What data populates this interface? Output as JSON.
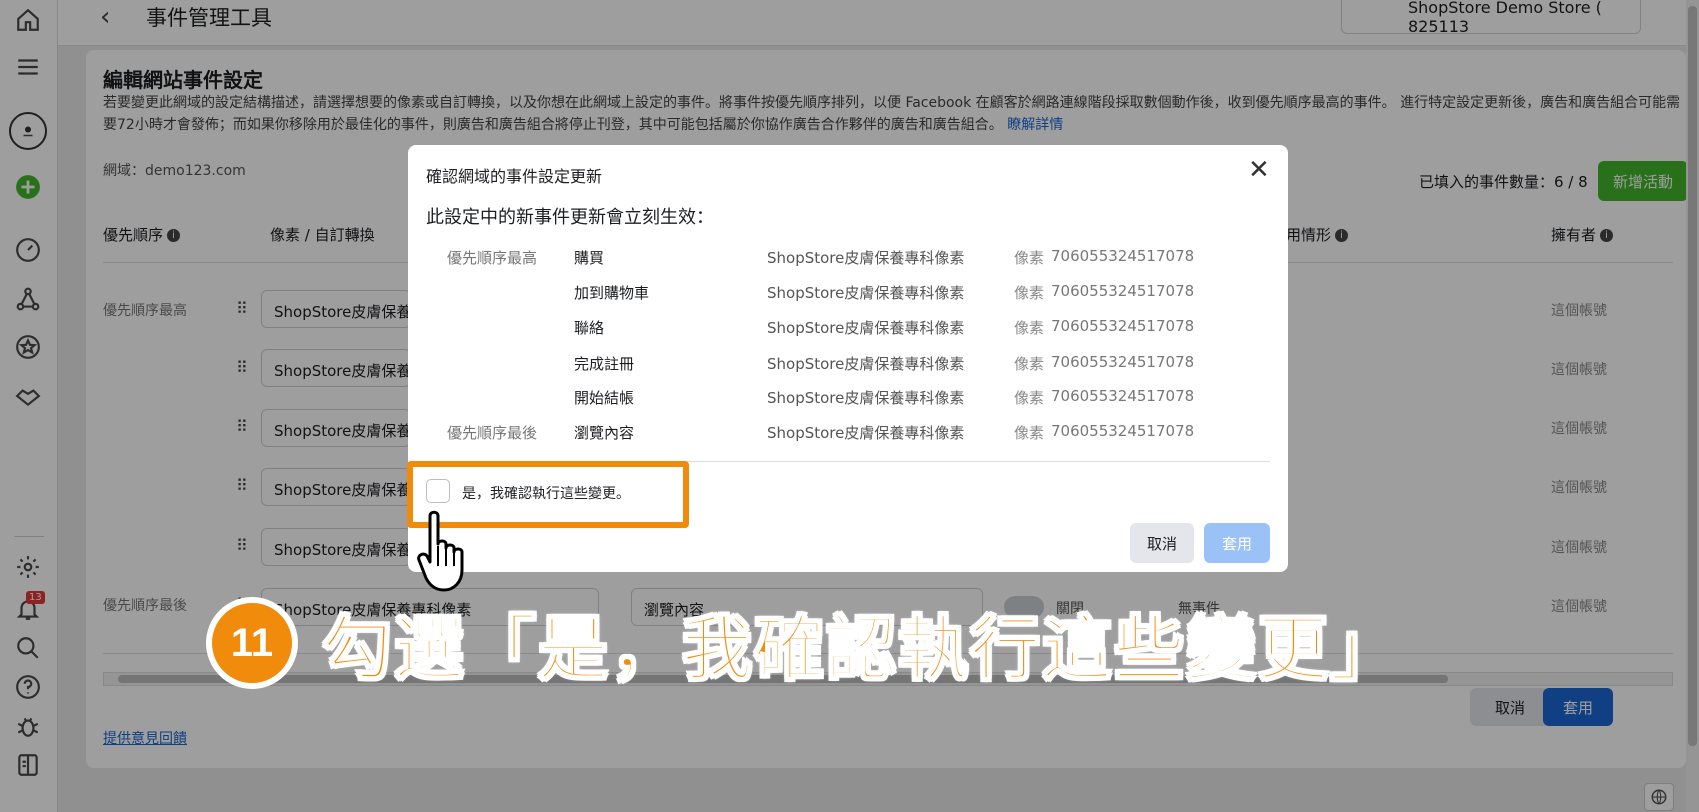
{
  "topbar": {
    "title": "事件管理工具",
    "store": "ShopStore Demo Store ( 825113"
  },
  "rail": {
    "notification_count": "13"
  },
  "page": {
    "heading": "編輯網站事件設定",
    "description": "若要變更此網域的設定結構描述，請選擇想要的像素或自訂轉換，以及你想在此網域上設定的事件。將事件按優先順序排列，以便 Facebook 在顧客於網路連線階段採取數個動作後，收到優先順序最高的事件。 進行特定設定更新後，廣告和廣告組合可能需要72小時才會發佈；而如果你移除用於最佳化的事件，則廣告和廣告組合將停止刊登，其中可能包括屬於你協作廣告合作夥伴的廣告和廣告組合。",
    "learn_more": "瞭解詳情",
    "domain": "網域：demo123.com",
    "event_count": "已填入的事件數量：6 / 8",
    "add_event": "新增活動",
    "col_priority": "優先順序",
    "col_pixel": "像素 / 自訂轉換",
    "col_usage": "用情形",
    "col_owner": "擁有者",
    "info_glyph": "i",
    "row_first": "優先順序最高",
    "row_last": "優先順序最後",
    "row_pixel": "ShopStore皮膚保養",
    "row_pixel_last": "ShopStore皮膚保養專科像素",
    "row_event_last": "瀏覽內容",
    "row_toggle_last": "關閉",
    "row_status_last": "無事件",
    "owner": "這個帳號",
    "feedback": "提供意見回饋",
    "cancel": "取消",
    "apply": "套用"
  },
  "modal": {
    "title": "確認網域的事件設定更新",
    "subtitle": "此設定中的新事件更新會立刻生效：",
    "pixel_tag": "像素",
    "events": [
      {
        "priority": "優先順序最高",
        "name": "購買",
        "pixel": "ShopStore皮膚保養專科像素",
        "id": "706055324517078"
      },
      {
        "priority": "",
        "name": "加到購物車",
        "pixel": "ShopStore皮膚保養專科像素",
        "id": "706055324517078"
      },
      {
        "priority": "",
        "name": "聯絡",
        "pixel": "ShopStore皮膚保養專科像素",
        "id": "706055324517078"
      },
      {
        "priority": "",
        "name": "完成註冊",
        "pixel": "ShopStore皮膚保養專科像素",
        "id": "706055324517078"
      },
      {
        "priority": "",
        "name": "開始結帳",
        "pixel": "ShopStore皮膚保養專科像素",
        "id": "706055324517078"
      },
      {
        "priority": "優先順序最後",
        "name": "瀏覽內容",
        "pixel": "ShopStore皮膚保養專科像素",
        "id": "706055324517078"
      }
    ],
    "confirm_label": "是，我確認執行這些變更。",
    "confirm_checked": false,
    "cancel": "取消",
    "apply": "套用"
  },
  "annotation": {
    "step_number": "11",
    "step_text": "勾選「是，我確認執行這些變更」",
    "accent_color": "#f18b0c"
  },
  "icons": {
    "rail": [
      "home-icon",
      "menu-icon",
      "store-logo-icon",
      "add-circle-icon",
      "dashboard-gauge-icon",
      "network-graph-icon",
      "star-circle-icon",
      "handshake-icon",
      "settings-gear-icon",
      "bell-icon",
      "search-icon",
      "help-icon",
      "bug-icon",
      "sidebar-toggle-icon"
    ]
  }
}
